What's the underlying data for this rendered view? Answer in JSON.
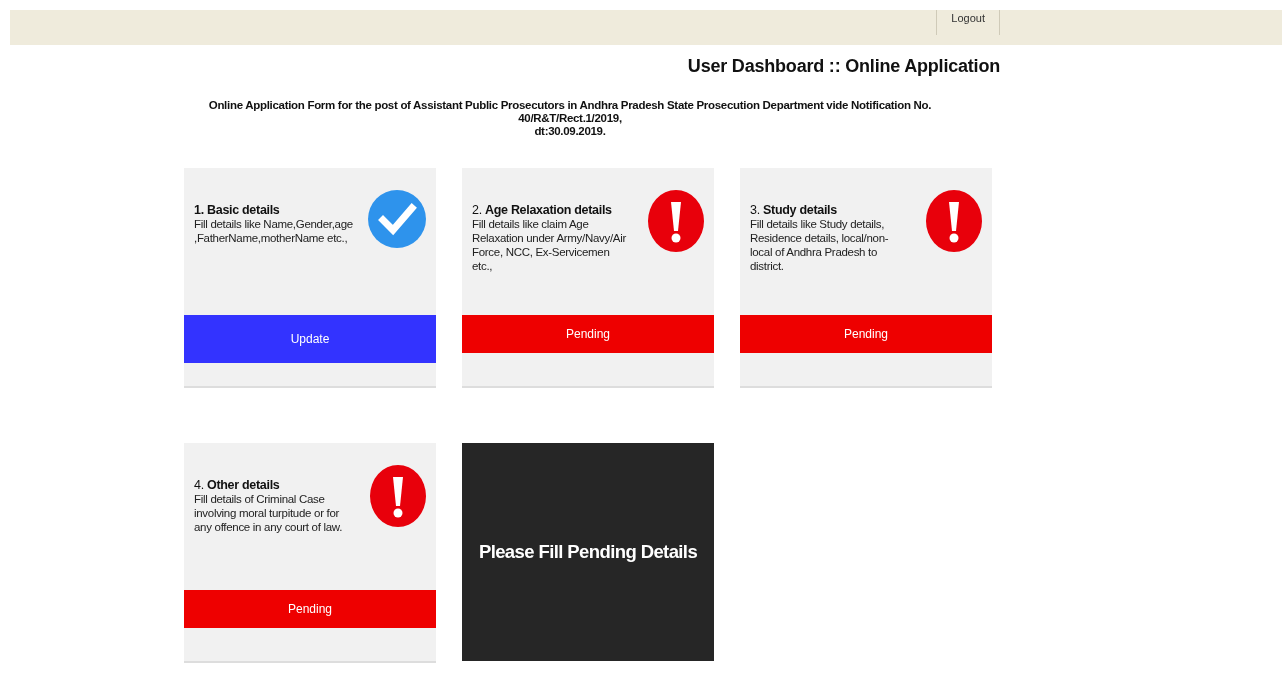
{
  "top_bar": {
    "logout": "Logout"
  },
  "heading": "User Dashboard :: Online Application",
  "notice": [
    "Online Application Form for the post of Assistant Public Prosecutors in Andhra Pradesh State Prosecution Department vide Notification No.",
    "40/R&T/Rect.1/2019,",
    "dt:30.09.2019."
  ],
  "cards": [
    {
      "kind": "done",
      "title": "**1. Basic details**",
      "description": " Fill details like Name,Gender,age ,FatherName,motherName etc.,",
      "button": "Update"
    },
    {
      "kind": "pending",
      "title": "2. **Age Relaxation details**",
      "description": " Fill details like claim Age Relaxation under Army/Navy/Air Force, NCC, Ex-Servicemen etc.,",
      "button": "Pending"
    },
    {
      "kind": "pending",
      "title": "3. **Study details**",
      "description": "Fill details like Study details, Residence details, local/non-local of Andhra Pradesh to district.",
      "button": "Pending"
    },
    {
      "kind": "pending",
      "title": "4. **Other details**",
      "description": "Fill details of Criminal Case involving moral turpitude or for any offence in any court of law.",
      "button": "Pending"
    }
  ],
  "message_panel": "Please Fill Pending Details"
}
